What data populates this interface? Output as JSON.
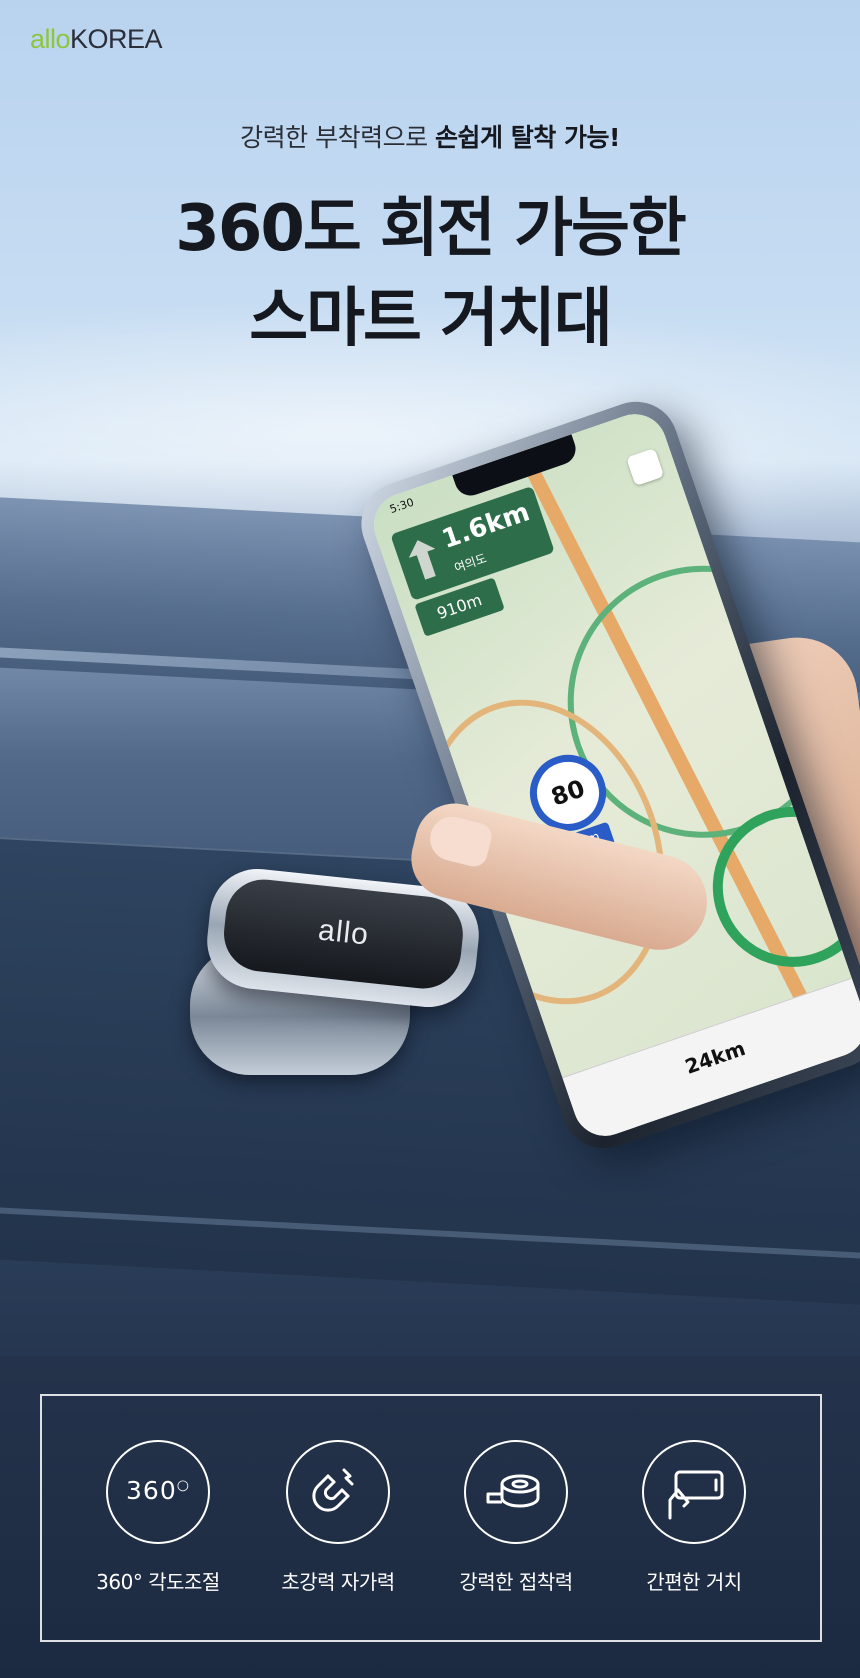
{
  "brand": {
    "prefix": "allo",
    "name": "KOREA"
  },
  "hero": {
    "subtitle_normal": "강력한 부착력으로 ",
    "subtitle_bold": "손쉽게 탈착 가능!",
    "title_line1": "360도 회전 가능한",
    "title_line2": "스마트 거치대"
  },
  "phone_screen": {
    "status_time": "5:30",
    "nav_distance": "1.6km",
    "nav_road": "여의도",
    "next_turn": "910m",
    "speed_limit": "80",
    "camera_distance": "942m",
    "current_speed": "24km"
  },
  "mount": {
    "logo": "allo"
  },
  "features": [
    {
      "icon": "rotation-360-icon",
      "icon_text": "360",
      "label": "360° 각도조절"
    },
    {
      "icon": "magnet-icon",
      "label": "초강력 자가력"
    },
    {
      "icon": "adhesive-tape-icon",
      "label": "강력한 접착력"
    },
    {
      "icon": "hand-phone-icon",
      "label": "간편한 거치"
    }
  ],
  "colors": {
    "brand_green": "#8cc63f",
    "panel_bg": "#1f2e46",
    "nav_green": "#2e6d4a",
    "speed_blue": "#2a5cc7"
  }
}
